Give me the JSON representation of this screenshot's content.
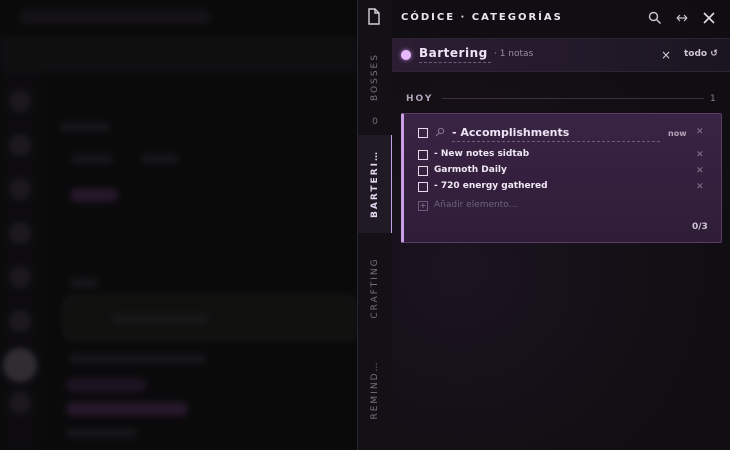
{
  "panel": {
    "title": "CÓDICE · CATEGORÍAS",
    "icons": {
      "doc": "document-icon",
      "search": "search-icon",
      "expand": "expand-horizontal-icon",
      "close": "close-icon"
    }
  },
  "tabs": [
    {
      "label": "BOSSES",
      "count": "0"
    },
    {
      "label": "BARTERI…",
      "active": true
    },
    {
      "label": "CRAFTING"
    },
    {
      "label": "REMIND…"
    }
  ],
  "category": {
    "name": "Bartering",
    "count": "· 1 notas",
    "close": "×",
    "todo": "todo ↺",
    "dot_color": "#e8b9ff"
  },
  "section": {
    "label": "HOY",
    "count": "1"
  },
  "card": {
    "title": "- Accomplishments",
    "time": "now",
    "items": [
      {
        "text": "- New notes sidtab"
      },
      {
        "text": "Garmoth Daily"
      },
      {
        "text": "- 720 energy gathered"
      }
    ],
    "add_label": "Añadir elemento…",
    "progress": "0/3",
    "accent": "#c9a0e6"
  }
}
